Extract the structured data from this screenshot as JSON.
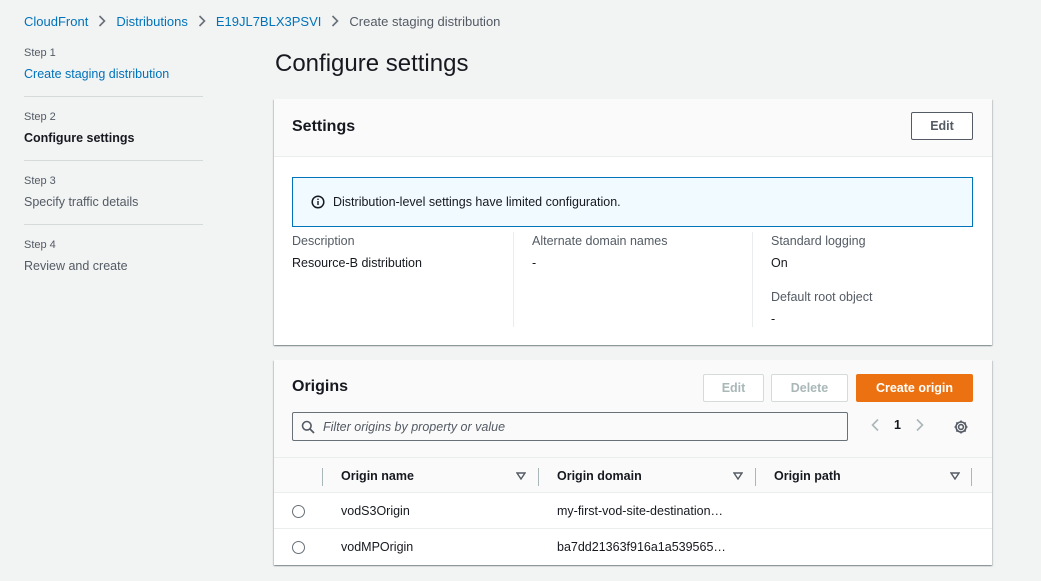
{
  "breadcrumb": {
    "items": [
      "CloudFront",
      "Distributions",
      "E19JL7BLX3PSVI"
    ],
    "current": "Create staging distribution"
  },
  "steps": [
    {
      "num": "Step 1",
      "title": "Create staging distribution",
      "state": "link"
    },
    {
      "num": "Step 2",
      "title": "Configure settings",
      "state": "active"
    },
    {
      "num": "Step 3",
      "title": "Specify traffic details",
      "state": "muted"
    },
    {
      "num": "Step 4",
      "title": "Review and create",
      "state": "muted"
    }
  ],
  "page": {
    "title": "Configure settings"
  },
  "settings": {
    "title": "Settings",
    "edit_label": "Edit",
    "alert": "Distribution-level settings have limited configuration.",
    "description_label": "Description",
    "description_value": "Resource-B distribution",
    "alt_domain_label": "Alternate domain names",
    "alt_domain_value": "-",
    "logging_label": "Standard logging",
    "logging_value": "On",
    "root_object_label": "Default root object",
    "root_object_value": "-"
  },
  "origins": {
    "title": "Origins",
    "edit_label": "Edit",
    "delete_label": "Delete",
    "create_label": "Create origin",
    "filter_placeholder": "Filter origins by property or value",
    "page": "1",
    "columns": [
      "Origin name",
      "Origin domain",
      "Origin path"
    ],
    "rows": [
      {
        "name": "vodS3Origin",
        "domain": "my-first-vod-site-destination…"
      },
      {
        "name": "vodMPOrigin",
        "domain": "ba7dd21363f916a1a539565…"
      }
    ]
  },
  "colors": {
    "link": "#0073bb",
    "primary": "#ec7211",
    "info_bg": "#f1faff"
  }
}
